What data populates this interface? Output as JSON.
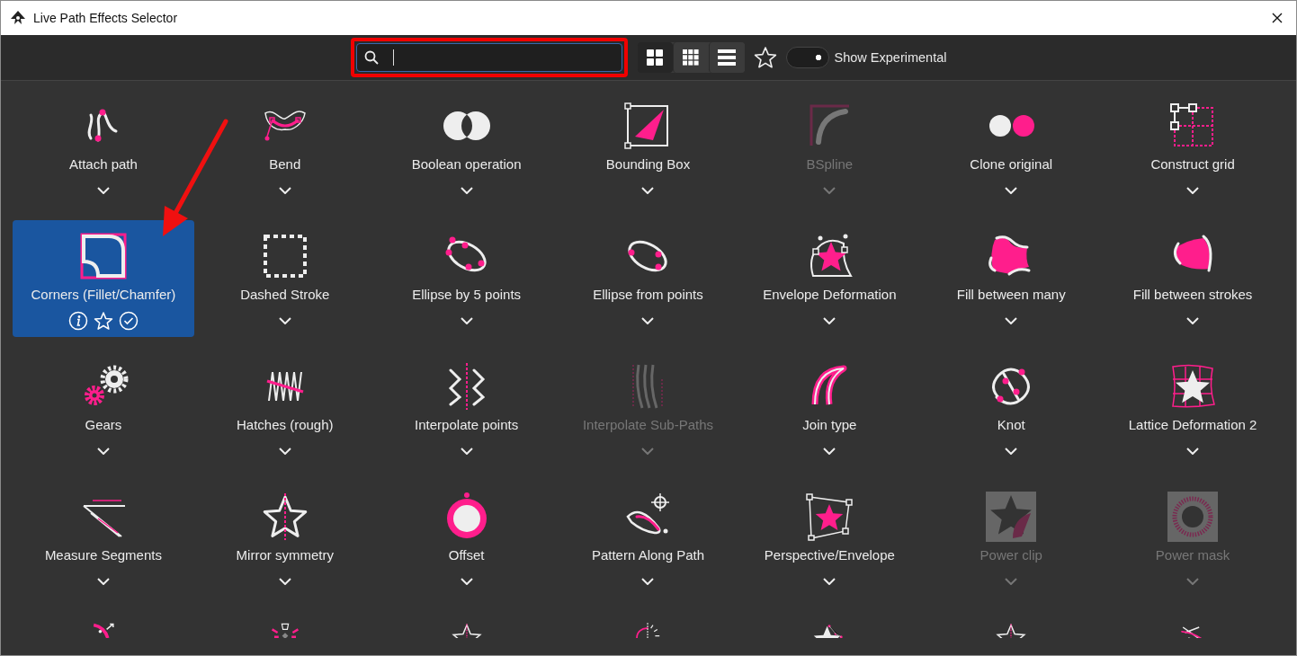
{
  "window": {
    "title": "Live Path Effects Selector"
  },
  "toolbar": {
    "view_buttons": [
      {
        "selected": true
      },
      {
        "selected": false
      },
      {
        "selected": false
      }
    ],
    "show_experimental": {
      "label": "Show Experimental",
      "on": true
    }
  },
  "effects": [
    {
      "label": "Attach path",
      "disabled": false,
      "selected": false
    },
    {
      "label": "Bend",
      "disabled": false,
      "selected": false
    },
    {
      "label": "Boolean operation",
      "disabled": false,
      "selected": false
    },
    {
      "label": "Bounding Box",
      "disabled": false,
      "selected": false
    },
    {
      "label": "BSpline",
      "disabled": true,
      "selected": false
    },
    {
      "label": "Clone original",
      "disabled": false,
      "selected": false
    },
    {
      "label": "Construct grid",
      "disabled": false,
      "selected": false
    },
    {
      "label": "Corners (Fillet/Chamfer)",
      "disabled": false,
      "selected": true
    },
    {
      "label": "Dashed Stroke",
      "disabled": false,
      "selected": false
    },
    {
      "label": "Ellipse by 5 points",
      "disabled": false,
      "selected": false
    },
    {
      "label": "Ellipse from points",
      "disabled": false,
      "selected": false
    },
    {
      "label": "Envelope Deformation",
      "disabled": false,
      "selected": false
    },
    {
      "label": "Fill between many",
      "disabled": false,
      "selected": false
    },
    {
      "label": "Fill between strokes",
      "disabled": false,
      "selected": false
    },
    {
      "label": "Gears",
      "disabled": false,
      "selected": false
    },
    {
      "label": "Hatches (rough)",
      "disabled": false,
      "selected": false
    },
    {
      "label": "Interpolate points",
      "disabled": false,
      "selected": false
    },
    {
      "label": "Interpolate Sub-Paths",
      "disabled": true,
      "selected": false
    },
    {
      "label": "Join type",
      "disabled": false,
      "selected": false
    },
    {
      "label": "Knot",
      "disabled": false,
      "selected": false
    },
    {
      "label": "Lattice Deformation 2",
      "disabled": false,
      "selected": false
    },
    {
      "label": "Measure Segments",
      "disabled": false,
      "selected": false
    },
    {
      "label": "Mirror symmetry",
      "disabled": false,
      "selected": false
    },
    {
      "label": "Offset",
      "disabled": false,
      "selected": false
    },
    {
      "label": "Pattern Along Path",
      "disabled": false,
      "selected": false
    },
    {
      "label": "Perspective/Envelope",
      "disabled": false,
      "selected": false
    },
    {
      "label": "Power clip",
      "disabled": true,
      "selected": false
    },
    {
      "label": "Power mask",
      "disabled": true,
      "selected": false
    },
    {
      "cut_off": true
    },
    {
      "cut_off": true
    },
    {
      "cut_off": true
    },
    {
      "cut_off": true
    },
    {
      "cut_off": true
    },
    {
      "cut_off": true
    },
    {
      "cut_off": true
    }
  ]
}
